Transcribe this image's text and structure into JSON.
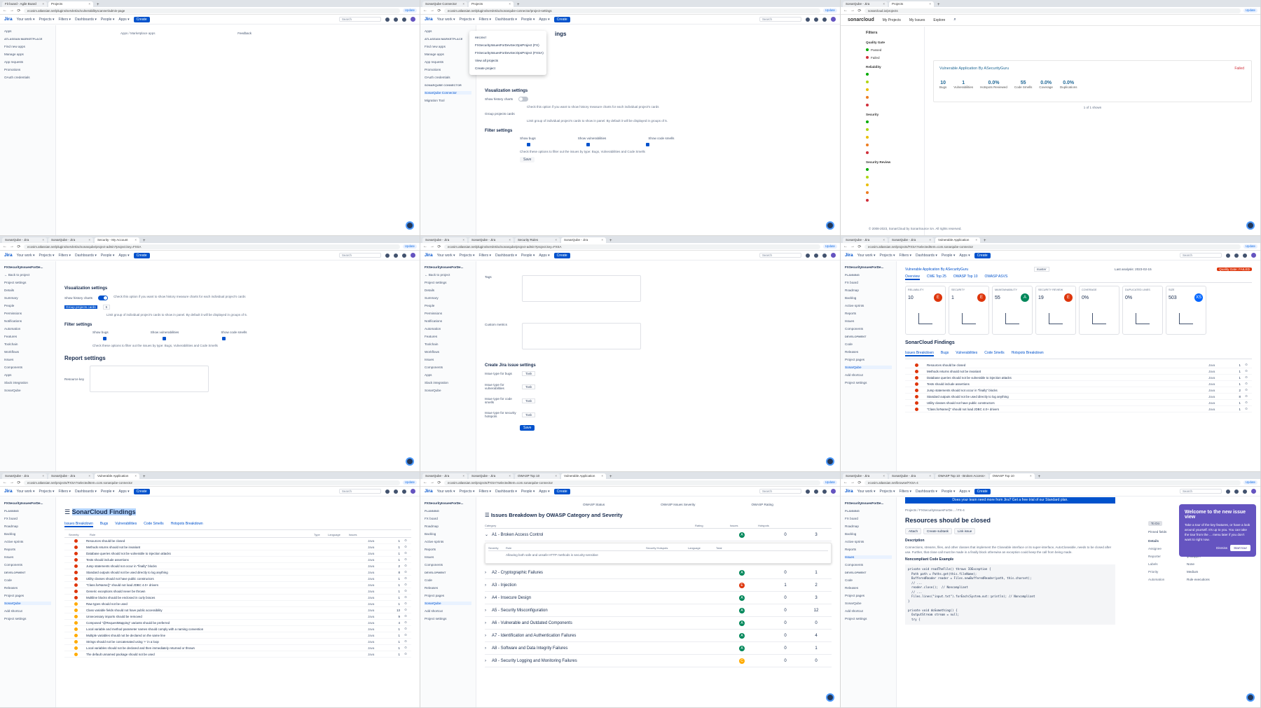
{
  "colors": {
    "jira_blue": "#0052cc",
    "sev_blocker": "#de350b",
    "sev_major": "#ff8b00",
    "grade_a": "#00875a",
    "grade_e": "#de350b",
    "grade_c": "#ffab00",
    "popup": "#6554c0"
  },
  "tabs": {
    "p1": [
      "Fit board - Agile Board",
      "Projects"
    ],
    "p2": [
      "SonarQube Connector",
      "Projects"
    ],
    "p3": [
      "SonarQube - Jira",
      "Projects"
    ],
    "p4": [
      "SonarQube - Jira",
      "SonarQube - Jira",
      "Security - My Account"
    ],
    "p5": [
      "SonarQube - Jira",
      "SonarQube - Jira",
      "Security Rules",
      "SonarQube - Jira"
    ],
    "p6": [
      "SonarQube - Jira",
      "SonarQube - Jira",
      "Vulnerable Application"
    ],
    "p7": [
      "SonarQube - Jira",
      "SonarQube - Jira",
      "Vulnerable Application"
    ],
    "p8": [
      "SonarQube - Jira",
      "SonarQube - Jira",
      "OWASP Top 10",
      "Vulnerable Application"
    ],
    "p9": [
      "SonarQube - Jira",
      "SonarQube - Jira",
      "OWASP Top 10 - Broken Access",
      "OWASP Top 10"
    ]
  },
  "urls": {
    "p1": "ecosim.atlassian.net/plugins/servlet/ac/vulnerabilityscanner/admin-page",
    "p2": "ecosim.atlassian.net/plugins/servlet/ac/sonarqube-connector/project-settings",
    "p3": "sonarcloud.io/projects",
    "p4": "ecosim.atlassian.net/plugins/servlet/ac/sonarqube/project-admin?project.key=FXSA",
    "p5": "ecosim.atlassian.net/plugins/servlet/ac/sonarqube/project-admin?project.key=FXSA",
    "p6": "ecosim.atlassian.net/projects/FXSA?selectedItem=com.sonarqube-connector",
    "p7": "ecosim.atlassian.net/projects/FXSA?selectedItem=com.sonarqube-connector",
    "p8": "ecosim.atlassian.net/projects/FXSA?selectedItem=com.sonarqube-connector",
    "p9": "ecosim.atlassian.net/browse/FXSA-4"
  },
  "jira_nav": {
    "logo": "Jira",
    "items": [
      "Your work",
      "Projects",
      "Filters",
      "Dashboards",
      "People",
      "Apps"
    ],
    "create": "Create",
    "search": "Search",
    "update": "Update"
  },
  "p1": {
    "sidebar": [
      "Apps",
      "ATLASSIAN MARKETPLACE",
      "Find new apps",
      "Manage apps",
      "App requests",
      "Promotions",
      "OAuth credentials"
    ],
    "breadcrumb": "Apps  /  Marketplace apps",
    "feedback": "Feedback"
  },
  "p2": {
    "dropdown_title": "RECENT",
    "dropdown_items": [
      "FXSecurityIssuesForDevSecOpsProject (FX)",
      "FXSecurityIssuesForDevSecOpsProject (FXSA)",
      "View all projects",
      "Create project"
    ],
    "heading": "ings",
    "sidebar": [
      "Apps",
      "ATLASSIAN MARKETPLACE",
      "Find new apps",
      "Manage apps",
      "App requests",
      "Promotions",
      "OAuth credentials",
      "SONARQUBE CONNECTOR",
      "SonarQube Connector",
      "Migration Tool"
    ],
    "vis_title": "Visualization settings",
    "show_history": "Show history charts",
    "history_help": "Check this option if you want to show history measure charts for each individual project's cards",
    "group_projects": "Group projects cards",
    "group_help": "Limit group of individual project's cards to show in panel. By default it will be displayed in groups of 5.",
    "filter_title": "Filter settings",
    "filter_cols": [
      "Show bugs",
      "Show vulnerabilities",
      "Show code smells"
    ],
    "filter_help": "Check these options to filter out the issues by type: Bugs, Vulnerabilities and Code Smells",
    "save": "Save"
  },
  "p3": {
    "logo": "sonarcloud",
    "nav": [
      "My Projects",
      "My Issues",
      "Explore"
    ],
    "filters_title": "Filters",
    "filter_groups": [
      "Quality Gate",
      "Reliability",
      "Security",
      "Security Review"
    ],
    "qg": [
      "Passed",
      "Failed"
    ],
    "project_name": "Vulnerable Application By ASecurityGuru",
    "qg_status": "Failed",
    "metrics": [
      {
        "value": "10",
        "label": "Bugs"
      },
      {
        "value": "1",
        "label": "Vulnerabilities"
      },
      {
        "value": "0.0%",
        "label": "Hotspots Reviewed"
      },
      {
        "value": "55",
        "label": "Code Smells"
      },
      {
        "value": "0.0%",
        "label": "Coverage"
      },
      {
        "value": "0.0%",
        "label": "Duplications"
      }
    ],
    "count": "1 of 1 shown",
    "footer": "© 2008-2023, SonarCloud by SonarSource SA. All rights reserved."
  },
  "p4": {
    "project": "FXSecurityIssuesForDe...",
    "back": "Back to project",
    "sidebar": [
      "Project settings",
      "Details",
      "Summary",
      "People",
      "Permissions",
      "Notifications",
      "Automation",
      "Features",
      "Toolchain",
      "Workflows",
      "Issues",
      "Components",
      "Apps",
      "Slack integration",
      "SonarQube"
    ],
    "vis_title": "Visualization settings",
    "show_history": "Show history charts",
    "history_help": "Check this option if you want to show history measure charts for each individual project's cards",
    "group_projects": "Group projects cards",
    "group_value": "5",
    "group_help": "Limit group of individual project's cards to show in panel. By default it will be displayed in groups of 5.",
    "filter_title": "Filter settings",
    "filter_cols": [
      "Show bugs",
      "Show vulnerabilities",
      "Show code smells"
    ],
    "filter_help": "Check these options to filter out the issues by type: Bugs, Vulnerabilities and Code Smells",
    "report_title": "Report settings",
    "resource_key": "Resource key"
  },
  "p5": {
    "project": "FXSecurityIssuesForDe...",
    "back": "Back to project",
    "sidebar": [
      "Project settings",
      "Details",
      "Summary",
      "People",
      "Permissions",
      "Notifications",
      "Automation",
      "Features",
      "Toolchain",
      "Workflows",
      "Issues",
      "Components",
      "Apps",
      "Slack integration",
      "SonarQube"
    ],
    "tags": "Tags",
    "custom_metrics": "Custom metrics",
    "create_title": "Create Jira issue settings",
    "issue_types": [
      {
        "label": "Issue type for bugs",
        "value": "Task"
      },
      {
        "label": "Issue type for vulnerabilities",
        "value": "Task"
      },
      {
        "label": "Issue type for code smells",
        "value": "Task"
      },
      {
        "label": "Issue type for security hotspots",
        "value": "Task"
      }
    ],
    "save": "Save"
  },
  "p6": {
    "project": "FXSecurityIssuesForDe...",
    "sidebar": [
      "PLANNING",
      "FX board",
      "Roadmap",
      "Backlog",
      "Active sprints",
      "Reports",
      "Issues",
      "Components",
      "DEVELOPMENT",
      "Code",
      "Releases",
      "Project pages",
      "SonarQube",
      "Add shortcut",
      "Project settings"
    ],
    "app_title": "Vulnerable Application By ASecurityGuru",
    "branch": "master",
    "last_analysis": "Last analysis: 2023-02-15",
    "qg": "Quality Gate: FAILED",
    "subtabs": [
      "Overview",
      "CWE Top 25",
      "OWASP Top 10",
      "OWASP ASVS"
    ],
    "cards": [
      {
        "label": "RELIABILITY",
        "value": "10",
        "grade": "E"
      },
      {
        "label": "SECURITY",
        "value": "1",
        "grade": "E"
      },
      {
        "label": "MAINTAINABILITY",
        "value": "55",
        "grade": "A"
      },
      {
        "label": "SECURITY REVIEW",
        "value": "19",
        "grade": "E"
      },
      {
        "label": "COVERAGE",
        "value": "0%",
        "grade": ""
      },
      {
        "label": "DUPLICATED LINES",
        "value": "0%",
        "grade": ""
      },
      {
        "label": "SIZE",
        "value": "503",
        "grade": "XS"
      }
    ],
    "findings_title": "SonarCloud Findings",
    "findings_tabs": [
      "Issues Breakdown",
      "Bugs",
      "Vulnerabilities",
      "Code Smells",
      "Hotspots Breakdown"
    ],
    "rows": [
      {
        "rule": "Resources should be closed",
        "lang": "Java",
        "count": "1"
      },
      {
        "rule": "Methods returns should not be invariant",
        "lang": "Java",
        "count": "1"
      },
      {
        "rule": "Database queries should not be vulnerable to injection attacks",
        "lang": "Java",
        "count": "1"
      },
      {
        "rule": "Tests should include assertions",
        "lang": "Java",
        "count": "1"
      },
      {
        "rule": "Jump statements should not occur in \"finally\" blocks",
        "lang": "Java",
        "count": "2"
      },
      {
        "rule": "Standard outputs should not be used directly to log anything",
        "lang": "Java",
        "count": "8"
      },
      {
        "rule": "Utility classes should not have public constructors",
        "lang": "Java",
        "count": "1"
      },
      {
        "rule": "\"Class.forName()\" should not load JDBC 4.0+ drivers",
        "lang": "Java",
        "count": "1"
      }
    ]
  },
  "p7": {
    "project": "FXSecurityIssuesForDe...",
    "sidebar": [
      "PLANNING",
      "FX board",
      "Roadmap",
      "Backlog",
      "Active sprints",
      "Reports",
      "Issues",
      "Components",
      "DEVELOPMENT",
      "Code",
      "Releases",
      "Project pages",
      "SonarQube",
      "Add shortcut",
      "Project settings"
    ],
    "findings_title": "SonarCloud Findings",
    "findings_tabs": [
      "Issues Breakdown",
      "Bugs",
      "Vulnerabilities",
      "Code Smells",
      "Hotspots Breakdown"
    ],
    "head": [
      "Severity",
      "Rule",
      "Type",
      "Language",
      "Issues"
    ],
    "rows": [
      {
        "rule": "Resources should be closed",
        "sev": "r",
        "count": "1"
      },
      {
        "rule": "Methods returns should not be invariant",
        "sev": "r",
        "count": "1"
      },
      {
        "rule": "Database queries should not be vulnerable to injection attacks",
        "sev": "r",
        "count": "1"
      },
      {
        "rule": "Tests should include assertions",
        "sev": "r",
        "count": "1"
      },
      {
        "rule": "Jump statements should not occur in \"finally\" blocks",
        "sev": "r",
        "count": "2"
      },
      {
        "rule": "Standard outputs should not be used directly to log anything",
        "sev": "r",
        "count": "8"
      },
      {
        "rule": "Utility classes should not have public constructors",
        "sev": "r",
        "count": "1"
      },
      {
        "rule": "\"Class.forName()\" should not load JDBC 4.0+ drivers",
        "sev": "r",
        "count": "1"
      },
      {
        "rule": "Generic exceptions should never be thrown",
        "sev": "r",
        "count": "1"
      },
      {
        "rule": "Multiline blocks should be enclosed in curly braces",
        "sev": "r",
        "count": "1"
      },
      {
        "rule": "Raw types should not be used",
        "sev": "o",
        "count": "1"
      },
      {
        "rule": "Class variable fields should not have public accessibility",
        "sev": "o",
        "count": "13"
      },
      {
        "rule": "Unnecessary imports should be removed",
        "sev": "o",
        "count": "9"
      },
      {
        "rule": "Composed \"@RequestMapping\" variants should be preferred",
        "sev": "o",
        "count": "4"
      },
      {
        "rule": "Local variable and method parameter names should comply with a naming convention",
        "sev": "o",
        "count": "1"
      },
      {
        "rule": "Multiple variables should not be declared on the same line",
        "sev": "o",
        "count": "1"
      },
      {
        "rule": "Strings should not be concatenated using '+' in a loop",
        "sev": "o",
        "count": "1"
      },
      {
        "rule": "Local variables should not be declared and then immediately returned or thrown",
        "sev": "o",
        "count": "1"
      },
      {
        "rule": "The default unnamed package should not be used",
        "sev": "o",
        "count": "1"
      }
    ]
  },
  "p8": {
    "project": "FXSecurityIssuesForDe...",
    "sidebar": [
      "PLANNING",
      "FX board",
      "Roadmap",
      "Backlog",
      "Active sprints",
      "Reports",
      "Issues",
      "Components",
      "DEVELOPMENT",
      "Code",
      "Releases",
      "Project pages",
      "SonarQube",
      "Add shortcut",
      "Project settings"
    ],
    "top_labels": [
      "OWASP Status",
      "OWASP Issues Severity",
      "OWASP Rating"
    ],
    "title": "Issues Breakdown by OWASP Category and Severity",
    "head": [
      "Category",
      "Rating",
      "Issues",
      "Hotspots"
    ],
    "rows": [
      {
        "label": "A1 - Broken Access Control",
        "grade": "A",
        "issues": "0",
        "hotspots": "3"
      },
      {
        "label": "A2 - Cryptographic Failures",
        "grade": "A",
        "issues": "0",
        "hotspots": "1"
      },
      {
        "label": "A3 - Injection",
        "grade": "E",
        "issues": "1",
        "hotspots": "2"
      },
      {
        "label": "A4 - Insecure Design",
        "grade": "A",
        "issues": "0",
        "hotspots": "3"
      },
      {
        "label": "A5 - Security Misconfiguration",
        "grade": "A",
        "issues": "0",
        "hotspots": "12"
      },
      {
        "label": "A6 - Vulnerable and Outdated Components",
        "grade": "A",
        "issues": "0",
        "hotspots": "0"
      },
      {
        "label": "A7 - Identification and Authentication Failures",
        "grade": "A",
        "issues": "0",
        "hotspots": "4"
      },
      {
        "label": "A8 - Software and Data Integrity Failures",
        "grade": "A",
        "issues": "0",
        "hotspots": "1"
      },
      {
        "label": "A9 - Security Logging and Monitoring Failures",
        "grade": "C",
        "issues": "0",
        "hotspots": "0"
      }
    ],
    "expand_head": [
      "Severity",
      "Rule",
      "Security Hotspots",
      "Language",
      "Total"
    ],
    "expand_row": "Allowing both safe and unsafe HTTP methods is security-sensitive"
  },
  "p9": {
    "project": "FXSecurityIssuesForDe...",
    "sidebar": [
      "PLANNING",
      "FX board",
      "Roadmap",
      "Backlog",
      "Active sprints",
      "Reports",
      "Issues",
      "Components",
      "DEVELOPMENT",
      "Code",
      "Releases",
      "Project pages",
      "SonarQube",
      "Add shortcut",
      "Project settings"
    ],
    "banner": "Does your team need more from Jira? Get a free trial of our Standard plan.",
    "breadcrumb": "Projects  /  FXSecurityIssuesForDe...  /  FX-4",
    "title": "Resources should be closed",
    "tools": [
      "Attach",
      "Create subtask",
      "Link issue"
    ],
    "desc_label": "Description",
    "desc": "Connections, streams, files, and other classes that implement the Closeable interface or its super-interface, AutoCloseable, needs to be closed after use. Further, that close call must be made in a finally block otherwise an exception could keep the call from being made.",
    "code_title": "Noncompliant Code Example",
    "code": "private void readTheFile() throws IOException {\n  Path path = Paths.get(this.fileName);\n  BufferedReader reader = Files.newBufferedReader(path, this.charset);\n  // ...\n  reader.close();  // Noncompliant\n  // ...\n  Files.lines(\"input.txt\").forEach(System.out::println); // Noncompliant\n}\n\nprivate void doSomething() {\n  OutputStream stream = null;\n  try {",
    "status": "To Do",
    "pinned": "Pinned fields",
    "details_title": "Details",
    "details": [
      {
        "k": "Assignee",
        "v": "Unassigned"
      },
      {
        "k": "Reporter",
        "v": "ipsuapper"
      },
      {
        "k": "Labels",
        "v": "None"
      },
      {
        "k": "Priority",
        "v": "Medium"
      },
      {
        "k": "Automation",
        "v": "Rule executions"
      }
    ],
    "popup_title": "Welcome to the new issue view",
    "popup_text": "Take a tour of the key features, or have a look around yourself. It's up to you. You can take the tour from the ... menu later if you don't want to right now.",
    "popup_dismiss": "Dismiss",
    "popup_tour": "Start tour"
  }
}
